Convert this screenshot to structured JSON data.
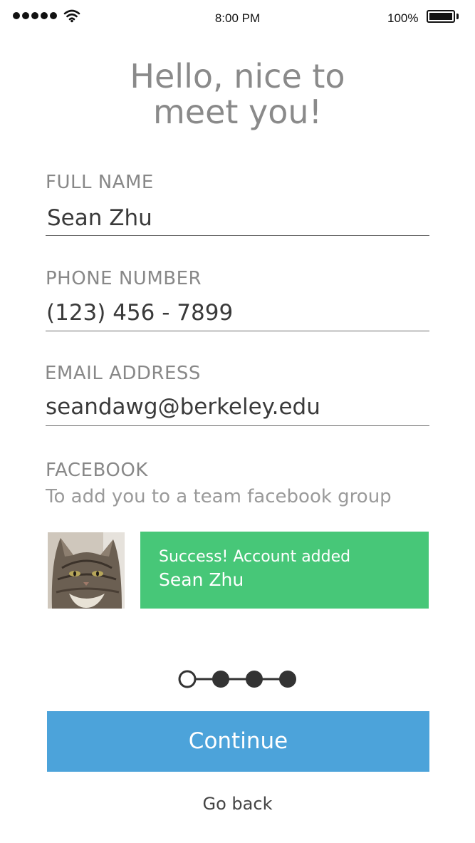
{
  "status_bar": {
    "time": "8:00 PM",
    "battery": "100%"
  },
  "heading": {
    "line1": "Hello, nice to",
    "line2": "meet you!"
  },
  "fields": {
    "full_name": {
      "label": "FULL NAME",
      "value": "Sean Zhu"
    },
    "phone": {
      "label": "PHONE NUMBER",
      "value": "(123) 456 - 7899"
    },
    "email": {
      "label": "EMAIL ADDRESS",
      "value": "seandawg@berkeley.edu"
    }
  },
  "facebook": {
    "label": "FACEBOOK",
    "subtitle": "To add you to a team facebook group",
    "status_message": "Success! Account added",
    "account_name": "Sean Zhu"
  },
  "progress": {
    "current_step": 1,
    "total_steps": 4
  },
  "actions": {
    "continue_label": "Continue",
    "back_label": "Go back"
  },
  "colors": {
    "success": "#47c778",
    "primary_button": "#4ca3da"
  }
}
